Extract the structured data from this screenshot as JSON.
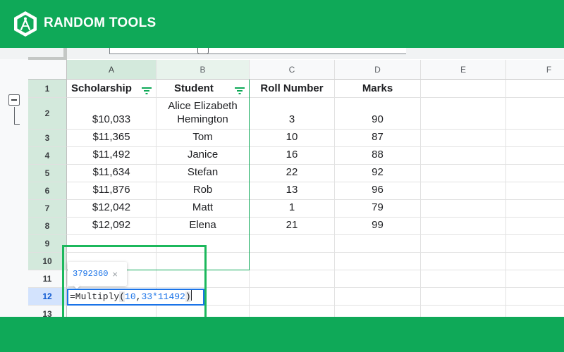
{
  "brand": {
    "name": "RANDOM TOOLS"
  },
  "colors": {
    "brand_green": "#0fa958",
    "selection_green": "#d3e9dc",
    "formula_blue": "#1a73e8"
  },
  "sheet": {
    "columns": [
      "A",
      "B",
      "C",
      "D",
      "E",
      "F"
    ],
    "rows": [
      "1",
      "2",
      "3",
      "4",
      "5",
      "6",
      "7",
      "8",
      "9",
      "10",
      "11",
      "12",
      "13"
    ],
    "headers": {
      "scholarship": "Scholarship",
      "student": "Student",
      "roll_number": "Roll Number",
      "marks": "Marks"
    },
    "data": [
      {
        "scholarship": "$10,033",
        "student": "Alice Elizabeth Hemington",
        "roll": "3",
        "marks": "90"
      },
      {
        "scholarship": "$11,365",
        "student": "Tom",
        "roll": "10",
        "marks": "87"
      },
      {
        "scholarship": "$11,492",
        "student": "Janice",
        "roll": "16",
        "marks": "88"
      },
      {
        "scholarship": "$11,634",
        "student": "Stefan",
        "roll": "22",
        "marks": "92"
      },
      {
        "scholarship": "$11,876",
        "student": "Rob",
        "roll": "13",
        "marks": "96"
      },
      {
        "scholarship": "$12,042",
        "student": "Matt",
        "roll": "1",
        "marks": "79"
      },
      {
        "scholarship": "$12,092",
        "student": "Elena",
        "roll": "21",
        "marks": "99"
      }
    ],
    "active_row": "12",
    "formula": {
      "prefix": "=Multiply",
      "open": "(",
      "arg1": "10",
      "sep": ",",
      "arg2": "33*11492",
      "close": ")"
    },
    "preview": {
      "value": "3792360",
      "close": "×"
    }
  }
}
